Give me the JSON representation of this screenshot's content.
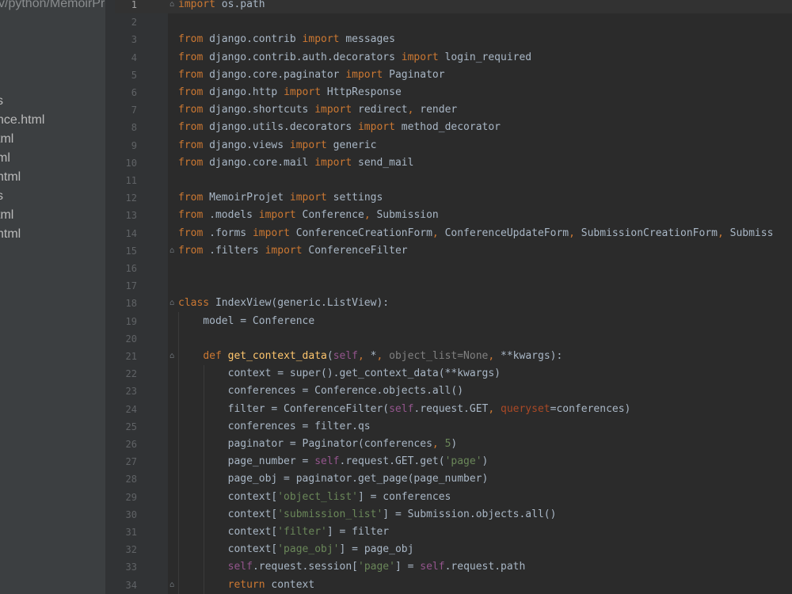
{
  "project_panel": {
    "path": "v/python/MemoirPro",
    "items": [
      "s",
      "nce.html",
      "tml",
      "ml",
      "html",
      "s",
      "tml",
      "html"
    ]
  },
  "editor": {
    "current_line": 1,
    "lines": [
      {
        "n": "1",
        "fold": true,
        "segs": [
          [
            "kw",
            "import"
          ],
          [
            "",
            " os.path"
          ]
        ]
      },
      {
        "n": "2",
        "segs": []
      },
      {
        "n": "3",
        "segs": [
          [
            "kw",
            "from"
          ],
          [
            "",
            " django.contrib "
          ],
          [
            "kw",
            "import"
          ],
          [
            "",
            " messages"
          ]
        ]
      },
      {
        "n": "4",
        "segs": [
          [
            "kw",
            "from"
          ],
          [
            "",
            " django.contrib.auth.decorators "
          ],
          [
            "kw",
            "import"
          ],
          [
            "",
            " login_required"
          ]
        ]
      },
      {
        "n": "5",
        "segs": [
          [
            "kw",
            "from"
          ],
          [
            "",
            " django.core.paginator "
          ],
          [
            "kw",
            "import"
          ],
          [
            "",
            " Paginator"
          ]
        ]
      },
      {
        "n": "6",
        "segs": [
          [
            "kw",
            "from"
          ],
          [
            "",
            " django.http "
          ],
          [
            "kw",
            "import"
          ],
          [
            "",
            " HttpResponse"
          ]
        ]
      },
      {
        "n": "7",
        "segs": [
          [
            "kw",
            "from"
          ],
          [
            "",
            " django.shortcuts "
          ],
          [
            "kw",
            "import"
          ],
          [
            "",
            " redirect"
          ],
          [
            "kw",
            ","
          ],
          [
            "",
            " render"
          ]
        ]
      },
      {
        "n": "8",
        "segs": [
          [
            "kw",
            "from"
          ],
          [
            "",
            " django.utils.decorators "
          ],
          [
            "kw",
            "import"
          ],
          [
            "",
            " method_decorator"
          ]
        ]
      },
      {
        "n": "9",
        "segs": [
          [
            "kw",
            "from"
          ],
          [
            "",
            " django.views "
          ],
          [
            "kw",
            "import"
          ],
          [
            "",
            " generic"
          ]
        ]
      },
      {
        "n": "10",
        "segs": [
          [
            "kw",
            "from"
          ],
          [
            "",
            " django.core.mail "
          ],
          [
            "kw",
            "import"
          ],
          [
            "",
            " send_mail"
          ]
        ]
      },
      {
        "n": "11",
        "segs": []
      },
      {
        "n": "12",
        "segs": [
          [
            "kw",
            "from"
          ],
          [
            "",
            " MemoirProjet "
          ],
          [
            "kw",
            "import"
          ],
          [
            "",
            " settings"
          ]
        ]
      },
      {
        "n": "13",
        "segs": [
          [
            "kw",
            "from"
          ],
          [
            "",
            " .models "
          ],
          [
            "kw",
            "import"
          ],
          [
            "",
            " Conference"
          ],
          [
            "kw",
            ","
          ],
          [
            "",
            " Submission"
          ]
        ]
      },
      {
        "n": "14",
        "segs": [
          [
            "kw",
            "from"
          ],
          [
            "",
            " .forms "
          ],
          [
            "kw",
            "import"
          ],
          [
            "",
            " ConferenceCreationForm"
          ],
          [
            "kw",
            ","
          ],
          [
            "",
            " ConferenceUpdateForm"
          ],
          [
            "kw",
            ","
          ],
          [
            "",
            " SubmissionCreationForm"
          ],
          [
            "kw",
            ","
          ],
          [
            "",
            " Submiss"
          ]
        ]
      },
      {
        "n": "15",
        "fold": true,
        "segs": [
          [
            "kw",
            "from"
          ],
          [
            "",
            " .filters "
          ],
          [
            "kw",
            "import"
          ],
          [
            "",
            " ConferenceFilter"
          ]
        ]
      },
      {
        "n": "16",
        "segs": []
      },
      {
        "n": "17",
        "segs": []
      },
      {
        "n": "18",
        "fold": true,
        "segs": [
          [
            "kw",
            "class"
          ],
          [
            "",
            " IndexView(generic.ListView):"
          ]
        ]
      },
      {
        "n": "19",
        "segs": [
          [
            "",
            "    model = Conference"
          ]
        ]
      },
      {
        "n": "20",
        "segs": []
      },
      {
        "n": "21",
        "fold": true,
        "segs": [
          [
            "",
            "    "
          ],
          [
            "kw",
            "def"
          ],
          [
            "",
            " "
          ],
          [
            "fn",
            "get_context_data"
          ],
          [
            "",
            "("
          ],
          [
            "self",
            "self"
          ],
          [
            "kw",
            ","
          ],
          [
            "",
            " *"
          ],
          [
            "kw",
            ","
          ],
          [
            "dim",
            " object_list=None"
          ],
          [
            "kw",
            ","
          ],
          [
            "",
            " **kwargs):"
          ]
        ]
      },
      {
        "n": "22",
        "segs": [
          [
            "",
            "        context = super().get_context_data(**kwargs)"
          ]
        ]
      },
      {
        "n": "23",
        "segs": [
          [
            "",
            "        conferences = Conference.objects.all()"
          ]
        ]
      },
      {
        "n": "24",
        "segs": [
          [
            "",
            "        filter = ConferenceFilter("
          ],
          [
            "self",
            "self"
          ],
          [
            "",
            ".request.GET"
          ],
          [
            "kw",
            ","
          ],
          [
            "",
            " "
          ],
          [
            "param",
            "queryset"
          ],
          [
            "",
            "=conferences)"
          ]
        ]
      },
      {
        "n": "25",
        "segs": [
          [
            "",
            "        conferences = filter.qs"
          ]
        ]
      },
      {
        "n": "26",
        "segs": [
          [
            "",
            "        paginator = Paginator(conferences"
          ],
          [
            "kw",
            ","
          ],
          [
            "",
            " "
          ],
          [
            "str",
            "5"
          ],
          [
            "",
            ")"
          ]
        ]
      },
      {
        "n": "27",
        "segs": [
          [
            "",
            "        page_number = "
          ],
          [
            "self",
            "self"
          ],
          [
            "",
            ".request.GET.get("
          ],
          [
            "str",
            "'page'"
          ],
          [
            "",
            ")"
          ]
        ]
      },
      {
        "n": "28",
        "segs": [
          [
            "",
            "        page_obj = paginator.get_page(page_number)"
          ]
        ]
      },
      {
        "n": "29",
        "segs": [
          [
            "",
            "        context["
          ],
          [
            "str",
            "'object_list'"
          ],
          [
            "",
            "] = conferences"
          ]
        ]
      },
      {
        "n": "30",
        "segs": [
          [
            "",
            "        context["
          ],
          [
            "str",
            "'submission_list'"
          ],
          [
            "",
            "] = Submission.objects.all()"
          ]
        ]
      },
      {
        "n": "31",
        "segs": [
          [
            "",
            "        context["
          ],
          [
            "str",
            "'filter'"
          ],
          [
            "",
            "] = filter"
          ]
        ]
      },
      {
        "n": "32",
        "segs": [
          [
            "",
            "        context["
          ],
          [
            "str",
            "'page_obj'"
          ],
          [
            "",
            "] = page_obj"
          ]
        ]
      },
      {
        "n": "33",
        "segs": [
          [
            "",
            "        "
          ],
          [
            "self",
            "self"
          ],
          [
            "",
            ".request.session["
          ],
          [
            "str",
            "'page'"
          ],
          [
            "",
            "] = "
          ],
          [
            "self",
            "self"
          ],
          [
            "",
            ".request.path"
          ]
        ]
      },
      {
        "n": "34",
        "fold": true,
        "segs": [
          [
            "",
            "        "
          ],
          [
            "kw",
            "return"
          ],
          [
            "",
            " context"
          ]
        ]
      }
    ]
  }
}
